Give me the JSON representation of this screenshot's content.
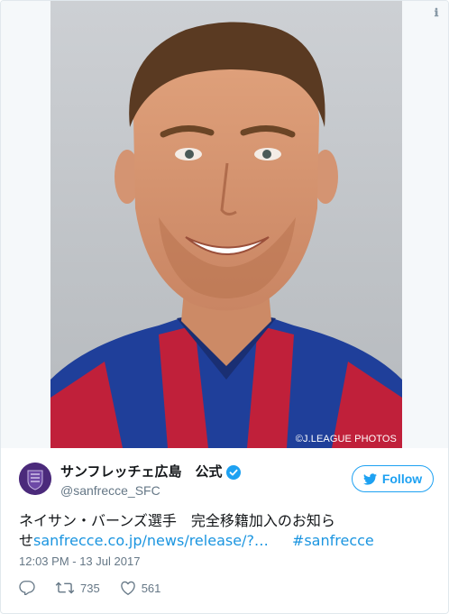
{
  "media": {
    "photo_credit": "©J.LEAGUE PHOTOS",
    "info_icon": "info-icon"
  },
  "author": {
    "display_name": "サンフレッチェ広島　公式",
    "handle": "@sanfrecce_SFC",
    "verified": true,
    "avatar_color": "#4b2a7b"
  },
  "follow_button": {
    "label": "Follow",
    "color": "#1da1f2"
  },
  "tweet": {
    "text_line1": "ネイサン・バーンズ選手　完全移籍加入のお知ら",
    "text_line2_prefix": "せ",
    "link": "sanfrecce.co.jp/news/release/?…",
    "hashtag": "#sanfrecce",
    "timestamp": "12:03 PM - 13 Jul 2017"
  },
  "actions": {
    "reply": {
      "icon": "reply-icon"
    },
    "retweet": {
      "icon": "retweet-icon",
      "count": "735"
    },
    "like": {
      "icon": "heart-icon",
      "count": "561"
    }
  }
}
